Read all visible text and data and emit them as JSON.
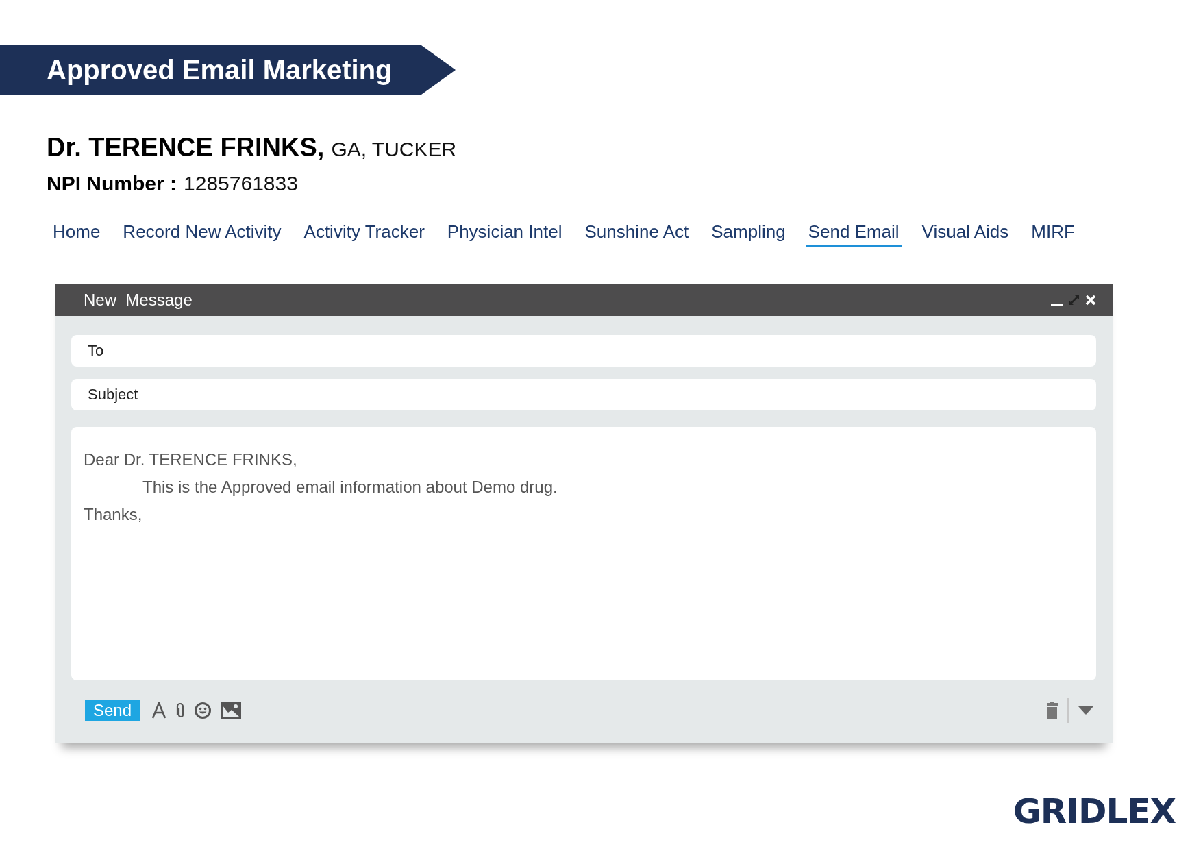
{
  "banner": {
    "title": "Approved Email Marketing"
  },
  "physician": {
    "name": "Dr. TERENCE FRINKS,",
    "location": "GA, TUCKER",
    "npi_label": "NPI Number :",
    "npi": "1285761833"
  },
  "nav": [
    {
      "label": "Home",
      "selected": false
    },
    {
      "label": "Record New Activity",
      "selected": false
    },
    {
      "label": "Activity Tracker",
      "selected": false
    },
    {
      "label": "Physician Intel",
      "selected": false
    },
    {
      "label": "Sunshine Act",
      "selected": false
    },
    {
      "label": "Sampling",
      "selected": false
    },
    {
      "label": "Send Email",
      "selected": true
    },
    {
      "label": "Visual Aids",
      "selected": false
    },
    {
      "label": "MIRF",
      "selected": false
    }
  ],
  "compose": {
    "title": "New  Message",
    "to": {
      "placeholder": "To"
    },
    "subject": {
      "placeholder": "Subject"
    },
    "body": [
      {
        "text": "Dear Dr. TERENCE FRINKS,",
        "indented": false
      },
      {
        "text": "This is the Approved email information about Demo drug.",
        "indented": true
      },
      {
        "text": "Thanks,",
        "indented": false
      }
    ],
    "send": "Send"
  },
  "logo": "GRIDLEX"
}
